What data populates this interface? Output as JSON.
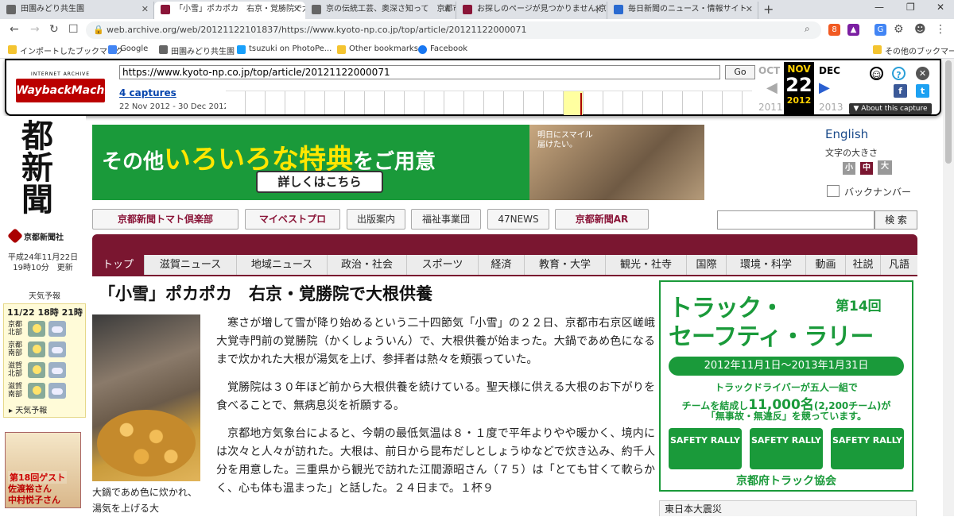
{
  "browser": {
    "tabs": [
      {
        "title": "田園みどり共生園",
        "color": "#666"
      },
      {
        "title": "「小雪」ポカポカ　右京・覚勝院で大根",
        "color": "#8a1538"
      },
      {
        "title": "京の伝統工芸、奥深さ知って　京都市",
        "color": "#666"
      },
      {
        "title": "お探しのページが見つかりません|京都新聞",
        "color": "#8a1538"
      },
      {
        "title": "毎日新聞のニュース・情報サイト",
        "color": "#2a6ad0"
      }
    ],
    "url": "web.archive.org/web/20121122101837/https://www.kyoto-np.co.jp/top/article/20121122000071",
    "bookmarks": [
      "インポートしたブックマーク",
      "Google",
      "田園みどり共生園",
      "tsuzuki on PhotoPe...",
      "Other bookmarks",
      "Facebook",
      "その他のブックマーク"
    ]
  },
  "wayback": {
    "logo_top": "INTERNET ARCHIVE",
    "logo": "WaybackMachine",
    "url": "https://www.kyoto-np.co.jp/top/article/20121122000071",
    "go": "Go",
    "captures": "4 captures",
    "range": "22 Nov 2012 - 30 Dec 2012",
    "prev_month": "OCT",
    "cur_month": "NOV",
    "next_month": "DEC",
    "day": "22",
    "prev_year": "2011",
    "cur_year": "2012",
    "next_year": "2013",
    "about": "▼ About this capture"
  },
  "site": {
    "logo_text": "都新聞",
    "company": "京都新聞社",
    "dateline1": "平成24年11月22日",
    "dateline2": "19時10分　更新",
    "english": "English",
    "font_size_label": "文字の大きさ",
    "font_small": "小",
    "font_mid": "中",
    "font_large": "大",
    "backnumber": "バックナンバー",
    "search_button": "検 索"
  },
  "weather": {
    "title": "天気予報",
    "header": "11/22 18時 21時",
    "regions": [
      {
        "l1": "京都",
        "l2": "北部"
      },
      {
        "l1": "京都",
        "l2": "南部"
      },
      {
        "l1": "滋賀",
        "l2": "北部"
      },
      {
        "l1": "滋賀",
        "l2": "南部"
      }
    ],
    "link": "天気予報"
  },
  "guest": {
    "line1": "第18回ゲスト",
    "line2": "佐渡裕さん",
    "line3": "中村悦子さん"
  },
  "banner": {
    "pre": "その他",
    "highlight": "いろいろな特典",
    "post": "をご用意",
    "button": "詳しくはこちら",
    "tag1": "明日にスマイル",
    "tag2": "届けたい。"
  },
  "services": [
    "京都新聞トマト倶楽部",
    "マイベストプロ",
    "出版案内",
    "福祉事業団",
    "47NEWS",
    "京都新聞AR"
  ],
  "categories": [
    "トップ",
    "滋賀ニュース",
    "地域ニュース",
    "政治・社会",
    "スポーツ",
    "経済",
    "教育・大学",
    "観光・社寺",
    "国際",
    "環境・科学",
    "動画",
    "社説",
    "凡語"
  ],
  "article": {
    "headline": "「小雪」ポカポカ　右京・覚勝院で大根供養",
    "caption": "大鍋であめ色に炊かれ、湯気を上げる大",
    "paragraphs": [
      "寒さが増して雪が降り始めるという二十四節気「小雪」の２２日、京都市右京区嵯峨大覚寺門前の覚勝院（かくしょういん）で、大根供養が始まった。大鍋であめ色になるまで炊かれた大根が湯気を上げ、参拝者は熱々を頬張っていた。",
      "覚勝院は３０年ほど前から大根供養を続けている。聖天様に供える大根のお下がりを食べることで、無病息災を祈願する。",
      "京都地方気象台によると、今朝の最低気温は８・１度で平年よりやや暖かく、境内には次々と人々が訪れた。大根は、前日から昆布だしとしょうゆなどで炊き込み、約千人分を用意した。三重県から観光で訪れた江間源昭さん（７５）は「とても甘くて軟らかく、心も体も温まった」と話した。２４日まで。１杯９"
    ]
  },
  "ad": {
    "title1": "トラック・",
    "title2": "セーフティ・ラリー",
    "number": "第14回",
    "date": "2012年11月1日〜2013年1月31日",
    "m1": "トラックドライバーが五人一組で",
    "m2a": "チームを結成し",
    "m2b": "11,000名",
    "m2c": "(2,200チーム)が",
    "m3": "「無事故・無違反」を競っています。",
    "truck": "SAFETY RALLY",
    "footer": "京都府トラック協会"
  },
  "sidebar_next": "東日本大震災"
}
